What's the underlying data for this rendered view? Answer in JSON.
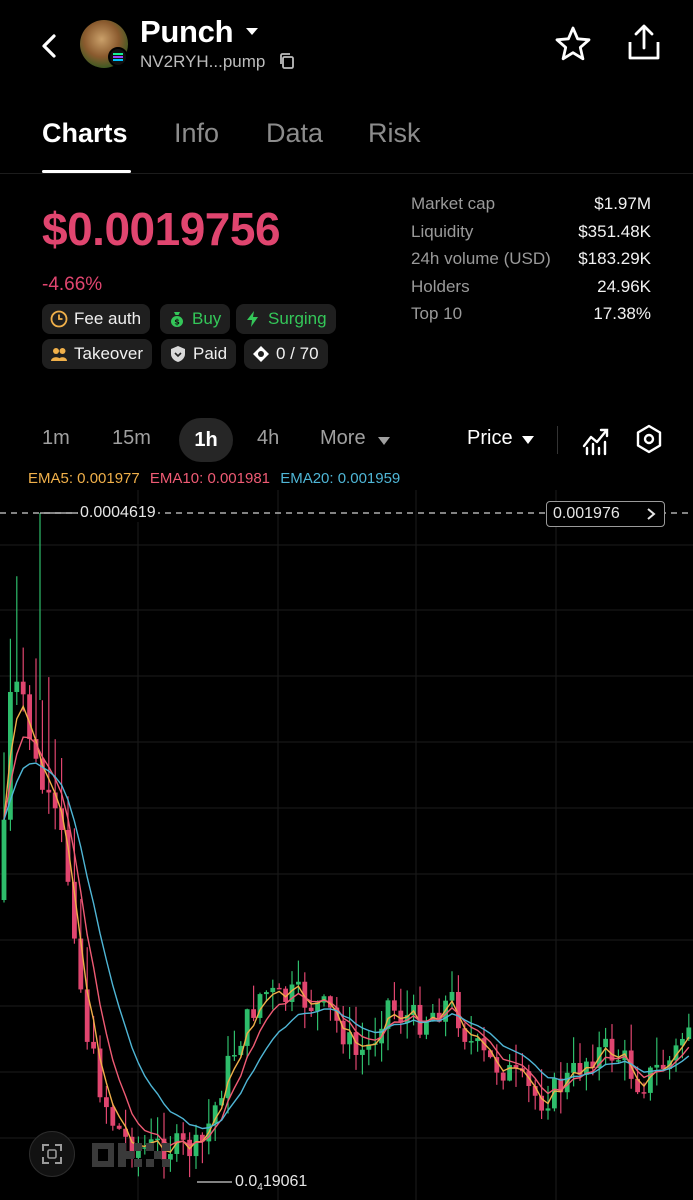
{
  "header": {
    "token_name": "Punch",
    "address": "NV2RYH...pump"
  },
  "tabs": [
    "Charts",
    "Info",
    "Data",
    "Risk"
  ],
  "price": {
    "value": "$0.0019756",
    "change": "-4.66%"
  },
  "stats": [
    {
      "label": "Market cap",
      "value": "$1.97M"
    },
    {
      "label": "Liquidity",
      "value": "$351.48K"
    },
    {
      "label": "24h volume (USD)",
      "value": "$183.29K"
    },
    {
      "label": "Holders",
      "value": "24.96K"
    },
    {
      "label": "Top 10",
      "value": "17.38%"
    }
  ],
  "badges": {
    "fee_auth": "Fee auth",
    "buy": "Buy",
    "surging": "Surging",
    "takeover": "Takeover",
    "paid": "Paid",
    "tasks": "0 / 70"
  },
  "timeframes": {
    "tf1": "1m",
    "tf2": "15m",
    "tf3": "1h",
    "tf4": "4h",
    "more": "More",
    "selected": "1h",
    "price_mode": "Price"
  },
  "ema": {
    "ema5": "EMA5: 0.001977",
    "ema10": "EMA10: 0.001981",
    "ema20": "EMA20: 0.001959"
  },
  "chart": {
    "current_price_label": "0.001976",
    "high_label": "0.0004619",
    "low_label_prefix": "0.0",
    "low_label_sub": "4",
    "low_label_suffix": "19061"
  },
  "colors": {
    "up": "#2ebd6b",
    "down": "#e0456f",
    "ema5": "#f0b04a",
    "ema10": "#ef5b74",
    "ema20": "#4fb6d6"
  },
  "icons": [
    "back-arrow-icon",
    "caret-down-icon",
    "copy-icon",
    "star-icon",
    "share-icon",
    "clock-icon",
    "money-bag-icon",
    "bolt-icon",
    "people-icon",
    "shield-icon",
    "target-icon",
    "indicator-icon",
    "settings-icon",
    "fullscreen-icon"
  ]
}
